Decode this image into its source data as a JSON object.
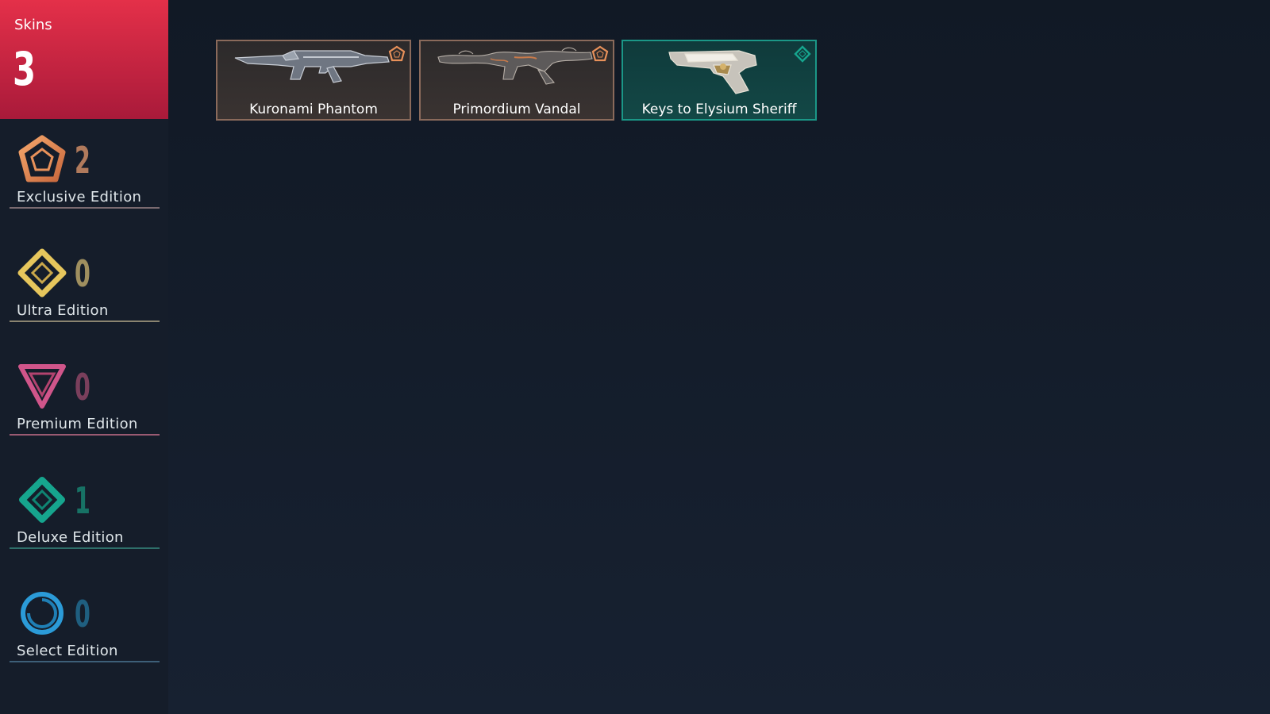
{
  "summary": {
    "label": "Skins",
    "count": "3",
    "color_top": "#e43049",
    "color_bottom": "#a91a3a"
  },
  "tiers": [
    {
      "label": "Exclusive Edition",
      "count": "2",
      "icon": "exclusive-tier-icon",
      "color": "#e8915a",
      "count_color": "#b07a5c",
      "line_color": "#7a6a70"
    },
    {
      "label": "Ultra Edition",
      "count": "0",
      "icon": "ultra-tier-icon",
      "color": "#e6c65c",
      "count_color": "#9f8f5f",
      "line_color": "#8a8470"
    },
    {
      "label": "Premium Edition",
      "count": "0",
      "icon": "premium-tier-icon",
      "color": "#d0558a",
      "count_color": "#7a3f5c",
      "line_color": "#9a5a72"
    },
    {
      "label": "Deluxe Edition",
      "count": "1",
      "icon": "deluxe-tier-icon",
      "color": "#16a58e",
      "count_color": "#177265",
      "line_color": "#2e6f6a"
    },
    {
      "label": "Select Edition",
      "count": "0",
      "icon": "select-tier-icon",
      "color": "#2b9bd8",
      "count_color": "#1f5f80",
      "line_color": "#3d5f78"
    }
  ],
  "skins": [
    {
      "name": "Kuronami Phantom",
      "tier": "Exclusive Edition",
      "weapon_icon": "phantom-rifle-icon"
    },
    {
      "name": "Primordium Vandal",
      "tier": "Exclusive Edition",
      "weapon_icon": "vandal-rifle-icon"
    },
    {
      "name": "Keys to Elysium Sheriff",
      "tier": "Deluxe Edition",
      "weapon_icon": "sheriff-pistol-icon"
    }
  ]
}
